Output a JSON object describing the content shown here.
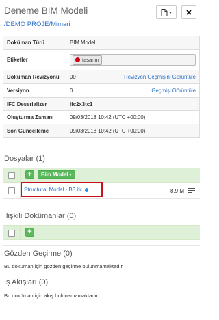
{
  "header": {
    "title": "Deneme BIM Modeli",
    "breadcrumb": "/DEMO PROJE/Mimari"
  },
  "meta_rows": {
    "doc_type": {
      "key": "Doküman Türü",
      "value": "BIM Model"
    },
    "tags": {
      "key": "Etiketler",
      "tag": "tasarim",
      "tag_color": "#d0021b"
    },
    "revision": {
      "key": "Doküman Revizyonu",
      "value": "00",
      "link": "Revizyon Geçmişini Görüntüle"
    },
    "version": {
      "key": "Versiyon",
      "value": "0",
      "link": "Geçmişi Görüntüle"
    },
    "ifc": {
      "key": "IFC Deserializer",
      "value": "Ifc2x3tc1"
    },
    "created": {
      "key": "Oluşturma Zamanı",
      "value": "09/03/2018 10:42 (UTC +00:00)"
    },
    "updated": {
      "key": "Son Güncelleme",
      "value": "09/03/2018 10:42 (UTC +00:00)"
    }
  },
  "files": {
    "title": "Dosyalar (1)",
    "add_label": "+",
    "model_button": "Bim Model",
    "items": [
      {
        "name": "Structural Model - B3.ifc",
        "size": "8.9 M"
      }
    ]
  },
  "related": {
    "title": "İlişkili Dokümanlar (0)",
    "add_label": "+"
  },
  "review": {
    "title": "Gözden Geçirme (0)",
    "message": "Bu doküman için gözden geçirme bulunmamaktadır"
  },
  "workflows": {
    "title": "İş Akışları (0)",
    "message": "Bu doküman için akış bulunamamaktadır"
  },
  "colors": {
    "accent_green": "#5cb85c",
    "link_blue": "#2a6fc9",
    "highlight_red": "#c6121f"
  }
}
